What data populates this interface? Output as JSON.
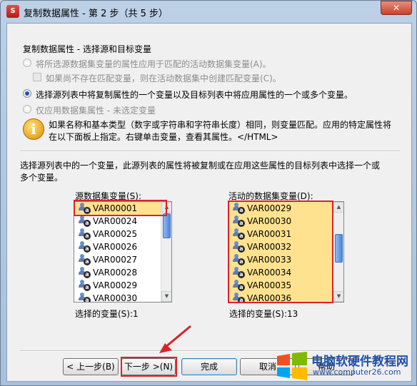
{
  "window": {
    "title": "复制数据属性 - 第 2 步（共 5 步）",
    "app_icon_glyph": "S",
    "close_glyph": "✕"
  },
  "section": {
    "title": "复制数据属性 - 选择源和目标变量"
  },
  "options": {
    "radio1_label": "将所选源数据集变量的属性应用于匹配的活动数据集变量(A)。",
    "checkbox_label": "如果尚不存在匹配变量，则在活动数据集中创建匹配变量(C)。",
    "radio2_label": "选择源列表中将复制属性的一个变量以及目标列表中将应用属性的一个或多个变量。",
    "radio3_label": "仅应用数据集属性 - 未选定变量"
  },
  "info": {
    "icon_glyph": "i",
    "line1": "如果名称和基本类型（数字或字符串和字符串长度）相同，则变量匹配。应用的特定属性将",
    "line2": "在以下面板上指定。右键单击变量，查看其属性。</HTML>"
  },
  "instruction": {
    "line1": "选择源列表中的一个变量，此源列表的属性将被复制或在应用这些属性的目标列表中选择一个或",
    "line2": "多个变量。"
  },
  "source_list": {
    "label": "源数据集变量(S):",
    "items": [
      "VAR00001",
      "VAR00024",
      "VAR00025",
      "VAR00026",
      "VAR00027",
      "VAR00028",
      "VAR00029",
      "VAR00030"
    ],
    "selected_count_label": "选择的变量(S):1"
  },
  "target_list": {
    "label": "活动的数据集变量(D):",
    "items": [
      "VAR00029",
      "VAR00030",
      "VAR00031",
      "VAR00032",
      "VAR00033",
      "VAR00034",
      "VAR00035",
      "VAR00036"
    ],
    "selected_count_label": "选择的变量(S):13"
  },
  "buttons": {
    "back": "< 上一步(B)",
    "next": "下一步 >(N)",
    "finish": "完成",
    "cancel": "取消",
    "help": "帮助"
  },
  "watermark": {
    "title": "电脑软硬件教程网",
    "url": "www.computer26.com"
  },
  "colors": {
    "selection": "#ffe28f",
    "highlight_frame": "#d9232a",
    "arrow": "#d9232a"
  }
}
